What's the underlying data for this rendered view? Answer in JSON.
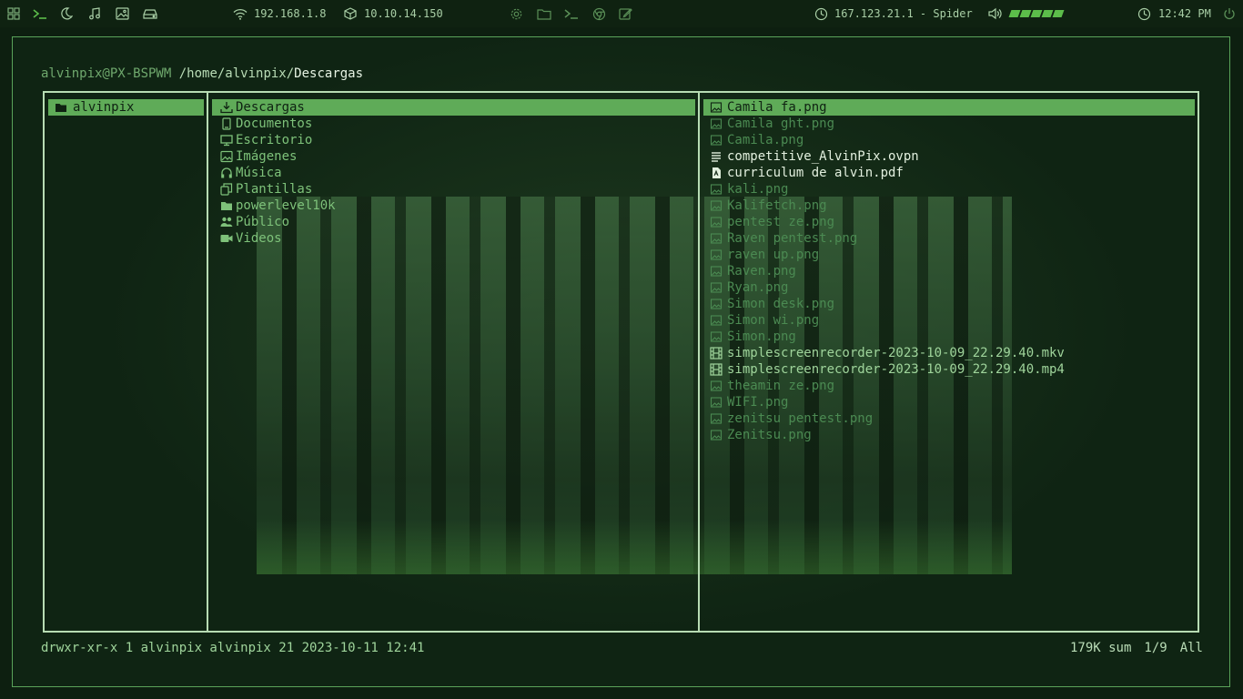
{
  "topbar": {
    "ip_wifi": "192.168.1.8",
    "ip_vpn": "10.10.14.150",
    "target": "167.123.21.1 - Spider",
    "volume_level": 5,
    "clock": "12:42 PM"
  },
  "terminal": {
    "prompt_host": "alvinpix@PX-BSPWM",
    "path_parent": "/home/alvinpix/",
    "path_current": "Descargas"
  },
  "parent_pane": [
    {
      "name": "alvinpix",
      "icon": "folder-icon",
      "selected": true
    }
  ],
  "current_pane": [
    {
      "name": "Descargas",
      "icon": "download-icon",
      "selected": true
    },
    {
      "name": "Documentos",
      "icon": "document-icon",
      "selected": false
    },
    {
      "name": "Escritorio",
      "icon": "monitor-icon",
      "selected": false
    },
    {
      "name": "Imágenes",
      "icon": "image-icon",
      "selected": false
    },
    {
      "name": "Música",
      "icon": "headphones-icon",
      "selected": false
    },
    {
      "name": "Plantillas",
      "icon": "copy-icon",
      "selected": false
    },
    {
      "name": "powerlevel10k",
      "icon": "folder-icon",
      "selected": false
    },
    {
      "name": "Público",
      "icon": "users-icon",
      "selected": false
    },
    {
      "name": "Videos",
      "icon": "video-icon",
      "selected": false
    }
  ],
  "preview_pane": [
    {
      "name": "Camila fa.png",
      "type": "image",
      "selected": true
    },
    {
      "name": "Camila ght.png",
      "type": "image",
      "selected": false
    },
    {
      "name": "Camila.png",
      "type": "image",
      "selected": false
    },
    {
      "name": "competitive_AlvinPix.ovpn",
      "type": "text",
      "selected": false
    },
    {
      "name": "curriculum de alvin.pdf",
      "type": "pdf",
      "selected": false
    },
    {
      "name": "kali.png",
      "type": "image",
      "selected": false
    },
    {
      "name": "Kalifetch.png",
      "type": "image",
      "selected": false
    },
    {
      "name": "pentest ze.png",
      "type": "image",
      "selected": false
    },
    {
      "name": "Raven pentest.png",
      "type": "image",
      "selected": false
    },
    {
      "name": "raven up.png",
      "type": "image",
      "selected": false
    },
    {
      "name": "Raven.png",
      "type": "image",
      "selected": false
    },
    {
      "name": "Ryan.png",
      "type": "image",
      "selected": false
    },
    {
      "name": "Simon desk.png",
      "type": "image",
      "selected": false
    },
    {
      "name": "Simon wi.png",
      "type": "image",
      "selected": false
    },
    {
      "name": "Simon.png",
      "type": "image",
      "selected": false
    },
    {
      "name": "simplescreenrecorder-2023-10-09_22.29.40.mkv",
      "type": "video",
      "selected": false
    },
    {
      "name": "simplescreenrecorder-2023-10-09_22.29.40.mp4",
      "type": "video",
      "selected": false
    },
    {
      "name": "theamin ze.png",
      "type": "image",
      "selected": false
    },
    {
      "name": "WIFI.png",
      "type": "image",
      "selected": false
    },
    {
      "name": "zenitsu pentest.png",
      "type": "image",
      "selected": false
    },
    {
      "name": "Zenitsu.png",
      "type": "image",
      "selected": false
    }
  ],
  "status": {
    "info": "drwxr-xr-x 1 alvinpix alvinpix 21 2023-10-11 12:41",
    "size_sum": "179K sum",
    "position": "1/9",
    "scroll": "All"
  },
  "colors": {
    "accent": "#5fab58",
    "border": "#b7dcb3",
    "background": "#0f2413"
  }
}
